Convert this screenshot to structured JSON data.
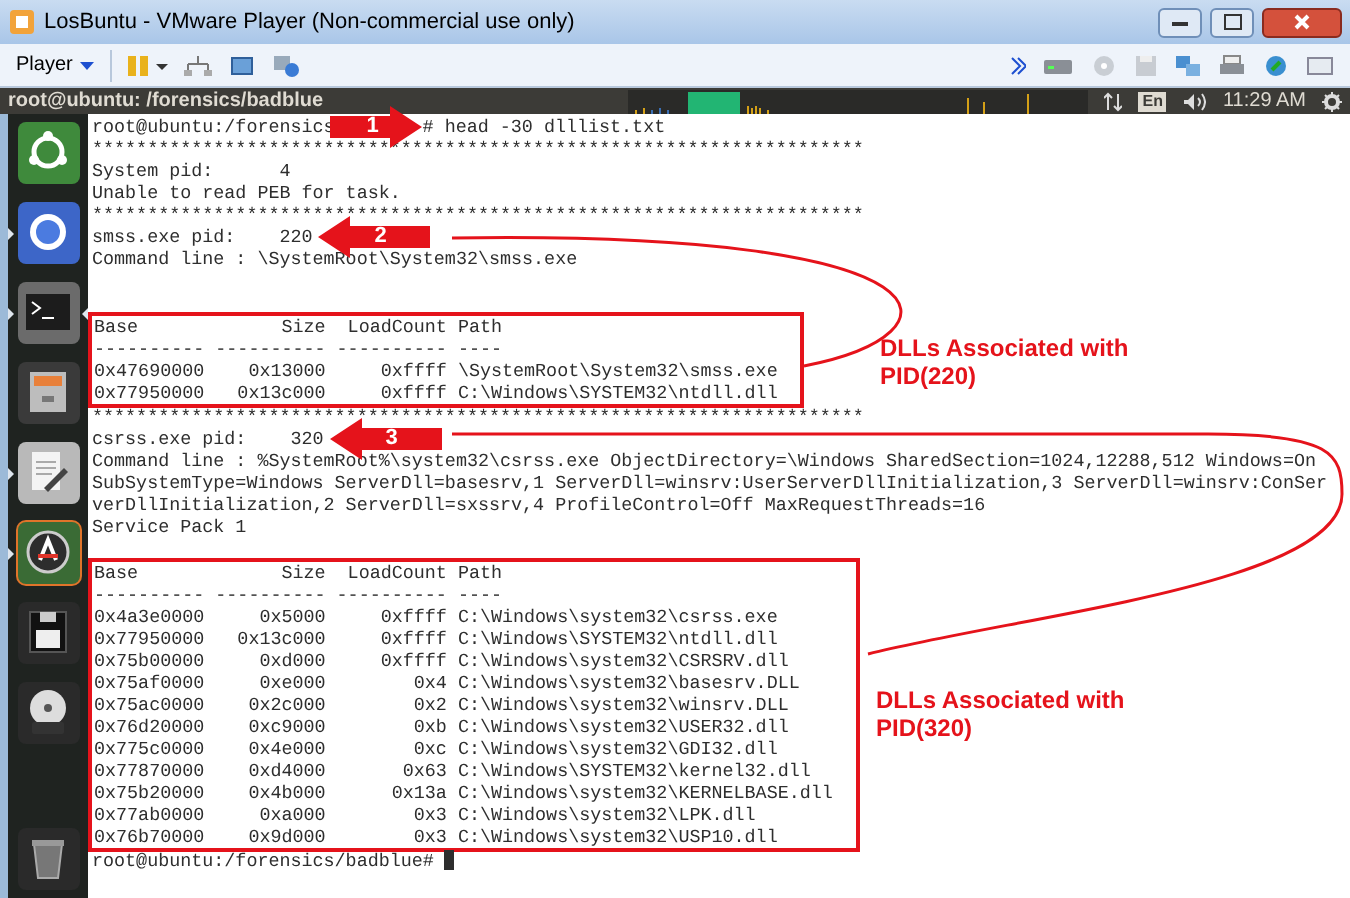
{
  "window": {
    "title": "LosBuntu - VMware Player (Non-commercial use only)"
  },
  "toolbar": {
    "player_menu": "Player"
  },
  "top_panel": {
    "title": "root@ubuntu: /forensics/badblue",
    "keyboard": "En",
    "clock": "11:29 AM"
  },
  "launcher": {
    "items": [
      {
        "kind": "ubuntu",
        "running": false,
        "focused": false
      },
      {
        "kind": "browser",
        "running": true,
        "focused": false
      },
      {
        "kind": "terminal",
        "running": true,
        "focused": true
      },
      {
        "kind": "files",
        "running": false,
        "focused": false
      },
      {
        "kind": "editor",
        "running": true,
        "focused": false
      },
      {
        "kind": "software",
        "running": true,
        "focused": false
      },
      {
        "kind": "floppy",
        "running": false,
        "focused": false
      },
      {
        "kind": "dvd",
        "running": false,
        "focused": false
      },
      {
        "kind": "trash",
        "running": false,
        "focused": false
      }
    ]
  },
  "terminal": {
    "blocks": [
      {
        "kind": "command",
        "prompt": "root@ubuntu:/forensics",
        "command": "# head -30 dlllist.txt",
        "marker": {
          "number": "1"
        }
      },
      {
        "kind": "text",
        "text": "**********************************************************************"
      },
      {
        "kind": "text",
        "text": "System pid:      4"
      },
      {
        "kind": "text",
        "text": "Unable to read PEB for task."
      },
      {
        "kind": "text",
        "text": "**********************************************************************"
      },
      {
        "kind": "text",
        "text": "smss.exe pid:    220",
        "marker": {
          "number": "2"
        }
      },
      {
        "kind": "text",
        "text": "Command line : \\SystemRoot\\System32\\smss.exe"
      },
      {
        "kind": "blank"
      },
      {
        "kind": "blank"
      },
      {
        "kind": "boxed",
        "lines": [
          "Base             Size  LoadCount Path",
          "---------- ---------- ---------- ----",
          "0x47690000    0x13000     0xffff \\SystemRoot\\System32\\smss.exe",
          "0x77950000   0x13c000     0xffff C:\\Windows\\SYSTEM32\\ntdll.dll"
        ]
      },
      {
        "kind": "text",
        "text": "**********************************************************************"
      },
      {
        "kind": "text",
        "text": "csrss.exe pid:    320",
        "marker": {
          "number": "3"
        }
      },
      {
        "kind": "text",
        "text": "Command line : %SystemRoot%\\system32\\csrss.exe ObjectDirectory=\\Windows SharedSection=1024,12288,512 Windows=On"
      },
      {
        "kind": "text",
        "text": "SubSystemType=Windows ServerDll=basesrv,1 ServerDll=winsrv:UserServerDllInitialization,3 ServerDll=winsrv:ConSer"
      },
      {
        "kind": "text",
        "text": "verDllInitialization,2 ServerDll=sxssrv,4 ProfileControl=Off MaxRequestThreads=16"
      },
      {
        "kind": "text",
        "text": "Service Pack 1"
      },
      {
        "kind": "blank"
      },
      {
        "kind": "boxed",
        "lines": [
          "Base             Size  LoadCount Path",
          "---------- ---------- ---------- ----",
          "0x4a3e0000     0x5000     0xffff C:\\Windows\\system32\\csrss.exe",
          "0x77950000   0x13c000     0xffff C:\\Windows\\SYSTEM32\\ntdll.dll",
          "0x75b00000     0xd000     0xffff C:\\Windows\\system32\\CSRSRV.dll",
          "0x75af0000     0xe000        0x4 C:\\Windows\\system32\\basesrv.DLL",
          "0x75ac0000    0x2c000        0x2 C:\\Windows\\system32\\winsrv.DLL",
          "0x76d20000    0xc9000        0xb C:\\Windows\\system32\\USER32.dll",
          "0x775c0000    0x4e000        0xc C:\\Windows\\system32\\GDI32.dll",
          "0x77870000    0xd4000       0x63 C:\\Windows\\SYSTEM32\\kernel32.dll",
          "0x75b20000    0x4b000      0x13a C:\\Windows\\system32\\KERNELBASE.dll",
          "0x77ab0000     0xa000        0x3 C:\\Windows\\system32\\LPK.dll",
          "0x76b70000    0x9d000        0x3 C:\\Windows\\system32\\USP10.dll"
        ]
      },
      {
        "kind": "prompt",
        "text": "root@ubuntu:/forensics/badblue#",
        "cursor": true
      }
    ]
  },
  "callouts": [
    "DLLs Associated with PID(220)",
    "DLLs Associated with PID(320)"
  ]
}
